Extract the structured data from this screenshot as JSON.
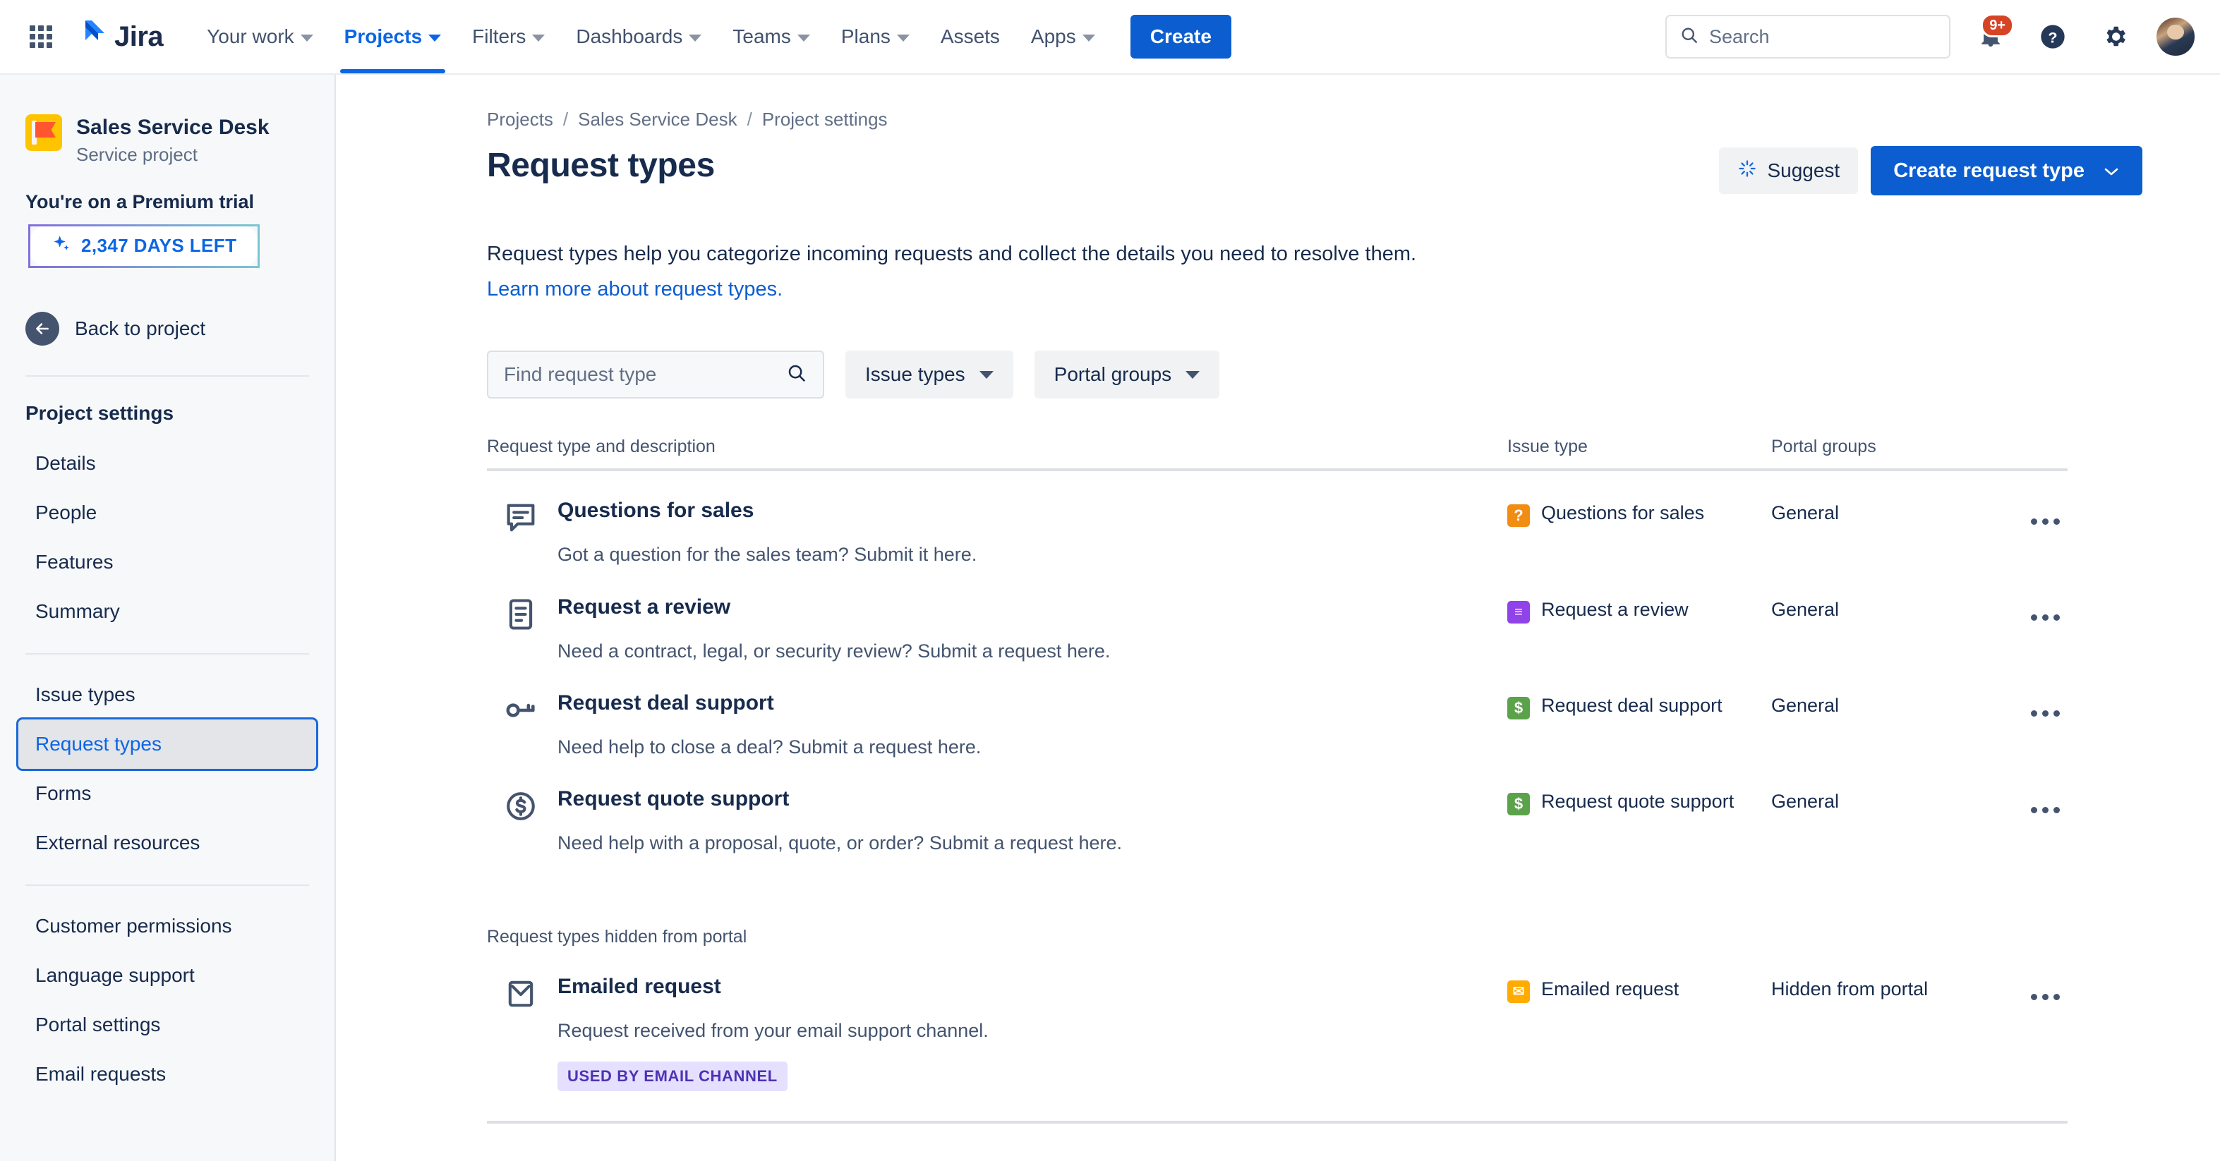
{
  "colors": {
    "brand_blue": "#0C5ED0",
    "link_blue": "#0C66E4",
    "text": "#172B4D",
    "subtle": "#44546F",
    "sidebar_bg": "#F7F8F9",
    "badge_orange": "#F18D13",
    "badge_purple": "#8F43E8",
    "badge_green": "#5BA34B",
    "badge_yellow": "#FFAB00",
    "notif_red": "#D64426",
    "tag_bg": "#E5E0FF",
    "tag_text": "#4E32B5"
  },
  "topnav": {
    "app_switcher_icon": "grid-apps-icon",
    "logo_icon": "jira-logo-icon",
    "logo_text": "Jira",
    "links": [
      {
        "label": "Your work",
        "has_chevron": true,
        "active": false
      },
      {
        "label": "Projects",
        "has_chevron": true,
        "active": true
      },
      {
        "label": "Filters",
        "has_chevron": true,
        "active": false
      },
      {
        "label": "Dashboards",
        "has_chevron": true,
        "active": false
      },
      {
        "label": "Teams",
        "has_chevron": true,
        "active": false
      },
      {
        "label": "Plans",
        "has_chevron": true,
        "active": false
      },
      {
        "label": "Assets",
        "has_chevron": false,
        "active": false
      },
      {
        "label": "Apps",
        "has_chevron": true,
        "active": false
      }
    ],
    "create_label": "Create",
    "search": {
      "placeholder": "Search",
      "icon": "search-icon"
    },
    "notifications": {
      "icon": "notifications-bell-icon",
      "count": "9+"
    },
    "help": {
      "icon": "help-question-icon"
    },
    "settings": {
      "icon": "gear-icon"
    },
    "profile": {
      "icon": "avatar"
    }
  },
  "sidebar": {
    "project": {
      "icon": "project-flag-avatar",
      "name": "Sales Service Desk",
      "type": "Service project"
    },
    "trial": {
      "label": "You're on a Premium trial",
      "pill_icon": "sparkle-icon",
      "pill_text": "2,347 DAYS LEFT"
    },
    "back": {
      "icon": "arrow-left-circle-icon",
      "label": "Back to project"
    },
    "settings_title": "Project settings",
    "groups": [
      {
        "items": [
          {
            "label": "Details",
            "selected": false
          },
          {
            "label": "People",
            "selected": false
          },
          {
            "label": "Features",
            "selected": false
          },
          {
            "label": "Summary",
            "selected": false
          }
        ]
      },
      {
        "items": [
          {
            "label": "Issue types",
            "selected": false
          },
          {
            "label": "Request types",
            "selected": true
          },
          {
            "label": "Forms",
            "selected": false
          },
          {
            "label": "External resources",
            "selected": false
          }
        ]
      },
      {
        "items": [
          {
            "label": "Customer permissions",
            "selected": false
          },
          {
            "label": "Language support",
            "selected": false
          },
          {
            "label": "Portal settings",
            "selected": false
          },
          {
            "label": "Email requests",
            "selected": false
          }
        ]
      }
    ]
  },
  "main": {
    "breadcrumb": [
      "Projects",
      "Sales Service Desk",
      "Project settings"
    ],
    "breadcrumb_separator": "/",
    "page_title": "Request types",
    "suggest_button": {
      "label": "Suggest",
      "icon": "sparkle-suggest-icon"
    },
    "create_button": {
      "label": "Create request type",
      "icon": "chevron-down-icon"
    },
    "description": "Request types help you categorize incoming requests and collect the details you need to resolve them.",
    "learn_more_link": "Learn more about request types.",
    "find_input": {
      "placeholder": "Find request type",
      "value": "",
      "icon": "search-icon"
    },
    "filters": [
      {
        "label": "Issue types",
        "icon": "chevron-down-icon"
      },
      {
        "label": "Portal groups",
        "icon": "chevron-down-icon"
      }
    ],
    "table": {
      "columns": [
        "Request type and description",
        "Issue type",
        "Portal groups"
      ],
      "rows": [
        {
          "icon": "comment-bubble-icon",
          "name": "Questions for sales",
          "description": "Got a question for the sales team? Submit it here.",
          "issue_type": "Questions for sales",
          "issue_badge_glyph": "?",
          "issue_badge_color": "#F18D13",
          "portal_group": "General",
          "more_icon": "more-horizontal-icon"
        },
        {
          "icon": "document-icon",
          "name": "Request a review",
          "description": "Need a contract, legal, or security review? Submit a request here.",
          "issue_type": "Request a review",
          "issue_badge_glyph": "≡",
          "issue_badge_color": "#8F43E8",
          "portal_group": "General",
          "more_icon": "more-horizontal-icon"
        },
        {
          "icon": "key-icon",
          "name": "Request deal support",
          "description": "Need help to close a deal? Submit a request here.",
          "issue_type": "Request deal support",
          "issue_badge_glyph": "$",
          "issue_badge_color": "#5BA34B",
          "portal_group": "General",
          "more_icon": "more-horizontal-icon"
        },
        {
          "icon": "dollar-circle-icon",
          "name": "Request quote support",
          "description": "Need help with a proposal, quote, or order? Submit a request here.",
          "issue_type": "Request quote support",
          "issue_badge_glyph": "$",
          "issue_badge_color": "#5BA34B",
          "portal_group": "General",
          "more_icon": "more-horizontal-icon"
        }
      ],
      "hidden_section_label": "Request types hidden from portal",
      "hidden_rows": [
        {
          "icon": "envelope-icon",
          "name": "Emailed request",
          "description": "Request received from your email support channel.",
          "tag": "USED BY EMAIL CHANNEL",
          "issue_type": "Emailed request",
          "issue_badge_glyph": "✉",
          "issue_badge_color": "#FFAB00",
          "portal_group": "Hidden from portal",
          "more_icon": "more-horizontal-icon"
        }
      ]
    }
  }
}
